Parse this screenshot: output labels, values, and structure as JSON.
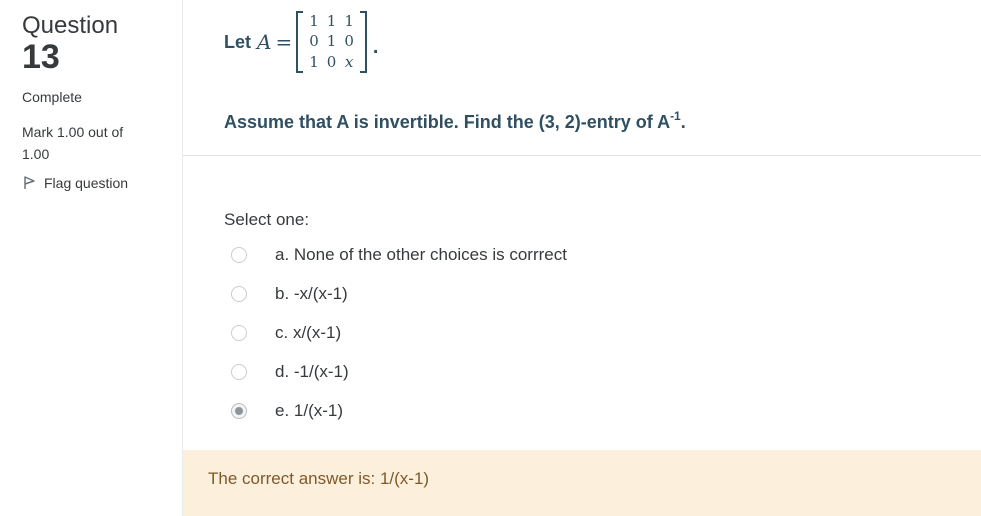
{
  "info": {
    "question_label": "Question",
    "question_number": "13",
    "state": "Complete",
    "grade": "Mark 1.00 out of 1.00",
    "flag_label": "Flag question",
    "flag_icon": "flag-icon"
  },
  "question": {
    "let_word": "Let",
    "matrix_var": "A",
    "equals": "=",
    "matrix": [
      [
        "1",
        "1",
        "1"
      ],
      [
        "0",
        "1",
        "0"
      ],
      [
        "1",
        "0",
        "x"
      ]
    ],
    "trailing_period": ".",
    "text_main": "Assume that A is invertible. Find the (3, 2)-entry of A",
    "text_sup": "-1",
    "text_end": "."
  },
  "answer": {
    "prompt": "Select one:",
    "options": [
      {
        "label": "a. None of the other choices is corrrect",
        "selected": false
      },
      {
        "label": "b. -x/(x-1)",
        "selected": false
      },
      {
        "label": "c. x/(x-1)",
        "selected": false
      },
      {
        "label": "d. -1/(x-1)",
        "selected": false
      },
      {
        "label": "e. 1/(x-1)",
        "selected": true
      }
    ]
  },
  "feedback": {
    "right_answer": "The correct answer is: 1/(x-1)"
  },
  "colors": {
    "question_text": "#2f5062",
    "feedback_bg": "#fcefdc",
    "feedback_text": "#7d5a29"
  }
}
